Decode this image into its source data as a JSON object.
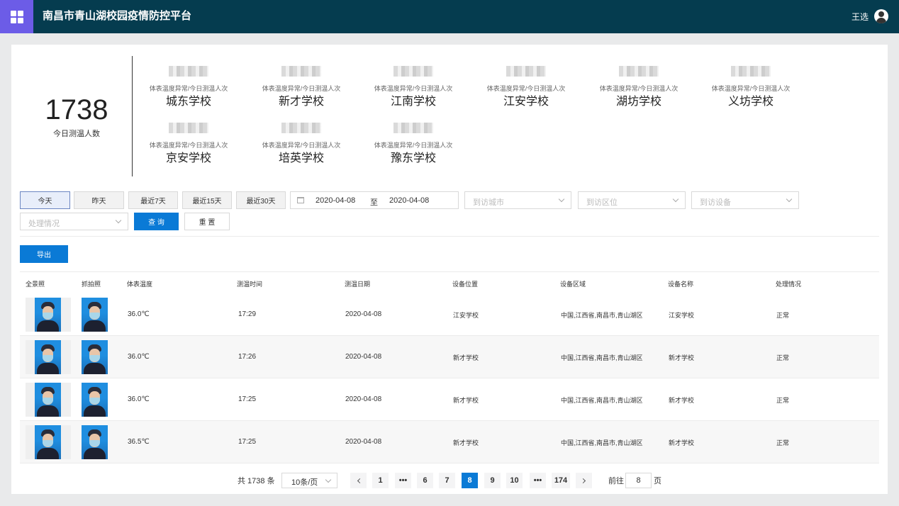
{
  "header": {
    "title": "南昌市青山湖校园疫情防控平台",
    "user_name": "王选"
  },
  "summary": {
    "total": "1738",
    "total_label": "今日测温人数",
    "stat_label": "体表温度异常/今日测温人次",
    "schools": [
      "城东学校",
      "新才学校",
      "江南学校",
      "江安学校",
      "湖坊学校",
      "义坊学校",
      "京安学校",
      "培英学校",
      "豫东学校"
    ]
  },
  "filters": {
    "today": "今天",
    "yesterday": "昨天",
    "last7": "最近7天",
    "last15": "最近15天",
    "last30": "最近30天",
    "date_start": "2020-04-08",
    "date_sep": "至",
    "date_end": "2020-04-08",
    "city_placeholder": "到访城市",
    "district_placeholder": "到访区位",
    "device_placeholder": "到访设备",
    "status_placeholder": "处理情况",
    "query": "查 询",
    "reset": "重 置",
    "export": "导出"
  },
  "table": {
    "columns": [
      "全景照",
      "抓拍照",
      "体表温度",
      "测温时间",
      "测温日期",
      "设备位置",
      "设备区域",
      "设备名称",
      "处理情况"
    ],
    "rows": [
      {
        "temp": "36.0℃",
        "time": "17:29",
        "date": "2020-04-08",
        "location": "江安学校",
        "region": "中国,江西省,南昌市,青山湖区",
        "device": "江安学校",
        "status": "正常"
      },
      {
        "temp": "36.0℃",
        "time": "17:26",
        "date": "2020-04-08",
        "location": "新才学校",
        "region": "中国,江西省,南昌市,青山湖区",
        "device": "新才学校",
        "status": "正常"
      },
      {
        "temp": "36.0℃",
        "time": "17:25",
        "date": "2020-04-08",
        "location": "新才学校",
        "region": "中国,江西省,南昌市,青山湖区",
        "device": "新才学校",
        "status": "正常"
      },
      {
        "temp": "36.5℃",
        "time": "17:25",
        "date": "2020-04-08",
        "location": "新才学校",
        "region": "中国,江西省,南昌市,青山湖区",
        "device": "新才学校",
        "status": "正常"
      }
    ]
  },
  "pagination": {
    "total_text": "共 1738 条",
    "page_size": "10条/页",
    "pages": [
      "1",
      "•••",
      "6",
      "7",
      "8",
      "9",
      "10",
      "•••",
      "174"
    ],
    "current": "8",
    "goto_prefix": "前往",
    "goto_value": "8",
    "goto_suffix": "页"
  }
}
